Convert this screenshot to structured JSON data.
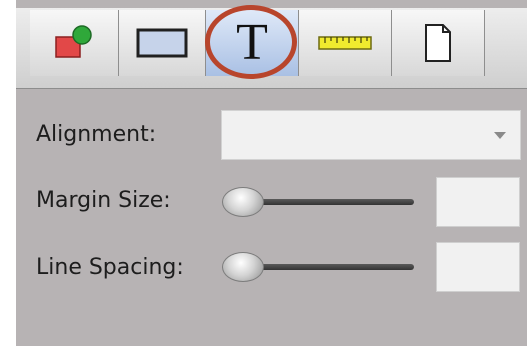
{
  "toolbar": {
    "tabs": [
      {
        "icon": "shapes-icon"
      },
      {
        "icon": "rectangle-icon"
      },
      {
        "icon": "text-icon",
        "glyph": "T",
        "selected": true
      },
      {
        "icon": "ruler-icon"
      },
      {
        "icon": "page-icon"
      }
    ]
  },
  "form": {
    "alignment_label": "Alignment:",
    "alignment_value": "",
    "margin_size_label": "Margin Size:",
    "margin_size_value": "",
    "line_spacing_label": "Line Spacing:",
    "line_spacing_value": ""
  },
  "colors": {
    "panel": "#b7b3b4",
    "selected_tab": "#a9c0e4",
    "highlight_ring": "#b8452c"
  }
}
